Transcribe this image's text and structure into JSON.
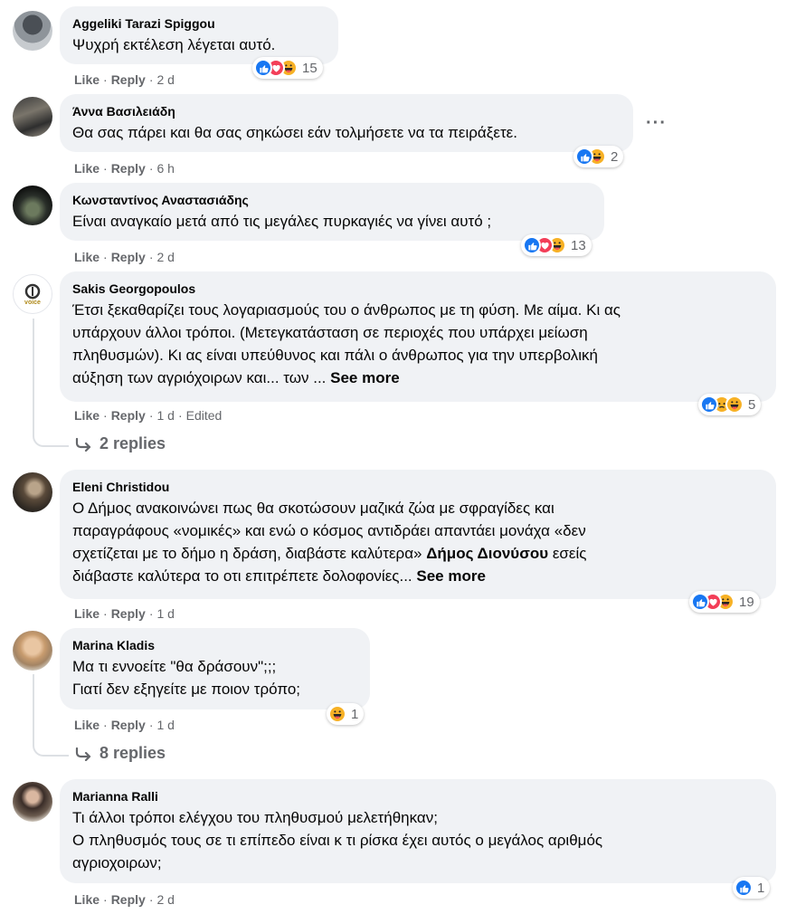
{
  "colors": {
    "bubble": "#f0f2f5",
    "muted": "#65676b",
    "like": "#1877f2",
    "love": "#f33e58",
    "haha": "#f7b125"
  },
  "actions": {
    "like": "Like",
    "reply": "Reply",
    "edited": "Edited"
  },
  "comments": [
    {
      "author": "Aggeliki Tarazi Spiggou",
      "text": "Ψυχρή εκτέλεση λέγεται αυτό.",
      "time": "2 d",
      "reactions": [
        "like",
        "love",
        "haha"
      ],
      "reaction_count": "15"
    },
    {
      "author": "Άννα Βασιλειάδη",
      "text": "Θα σας πάρει και θα σας σηκώσει εάν τολμήσετε να τα πειράξετε.",
      "time": "6 h",
      "reactions": [
        "like",
        "haha"
      ],
      "reaction_count": "2",
      "more_options": "···"
    },
    {
      "author": "Κωνσταντίνος Αναστασιάδης",
      "text": "Είναι αναγκαίο μετά από τις μεγάλες πυρκαγιές να γίνει αυτό ;",
      "time": "2 d",
      "reactions": [
        "like",
        "love",
        "haha"
      ],
      "reaction_count": "13"
    },
    {
      "author": "Sakis Georgopoulos",
      "text_lines": [
        "Έτσι ξεκαθαρίζει τους λογαριασμούς του ο άνθρωπος με τη φύση. Με αίμα. Κι ας",
        "υπάρχουν άλλοι τρόποι. (Μετεγκατάσταση σε περιοχές που υπάρχει μείωση",
        "πληθυσμών). Κι ας είναι υπεύθυνος και πάλι ο άνθρωπος για την υπερβολική",
        "αύξηση των αγριόχοιρων και... των ... "
      ],
      "see_more": "See more",
      "time": "1 d",
      "reactions": [
        "like",
        "sad",
        "haha"
      ],
      "reaction_count": "5",
      "replies": "2 replies",
      "avatar_text": "voice"
    },
    {
      "author": "Eleni Christidou",
      "text_lines": [
        "Ο Δήμος ανακοινώνει πως θα σκοτώσουν μαζικά ζώα με σφραγίδες και",
        "παραγράφους «νομικές» και ενώ ο κόσμος αντιδράει απαντάει μονάχα «δεν",
        "σχετίζεται με το δήμο η δράση, διαβάστε καλύτερα» "
      ],
      "mention": "Δήμος Διονύσου",
      "text_after_mention": " εσείς",
      "last_line": "διάβαστε καλύτερα το οτι επιτρέπετε δολοφονίες... ",
      "see_more": "See more",
      "time": "1 d",
      "reactions": [
        "like",
        "love",
        "haha"
      ],
      "reaction_count": "19"
    },
    {
      "author": "Marina Kladis",
      "text_lines": [
        "Μα τι εννοείτε \"θα δράσουν\";;;",
        "Γιατί δεν εξηγείτε με ποιον τρόπο;"
      ],
      "time": "1 d",
      "reactions": [
        "haha"
      ],
      "reaction_count": "1",
      "replies": "8 replies"
    },
    {
      "author": "Marianna Ralli",
      "text_lines": [
        "Τι άλλοι τρόποι ελέγχου του πληθυσμού μελετήθηκαν;",
        "Ο πληθυσμός τους σε τι επίπεδο είναι κ τι ρίσκα έχει αυτός ο μεγάλος αριθμός",
        "αγριοχοιρων;"
      ],
      "time": "2 d",
      "reactions": [
        "like"
      ],
      "reaction_count": "1"
    }
  ]
}
